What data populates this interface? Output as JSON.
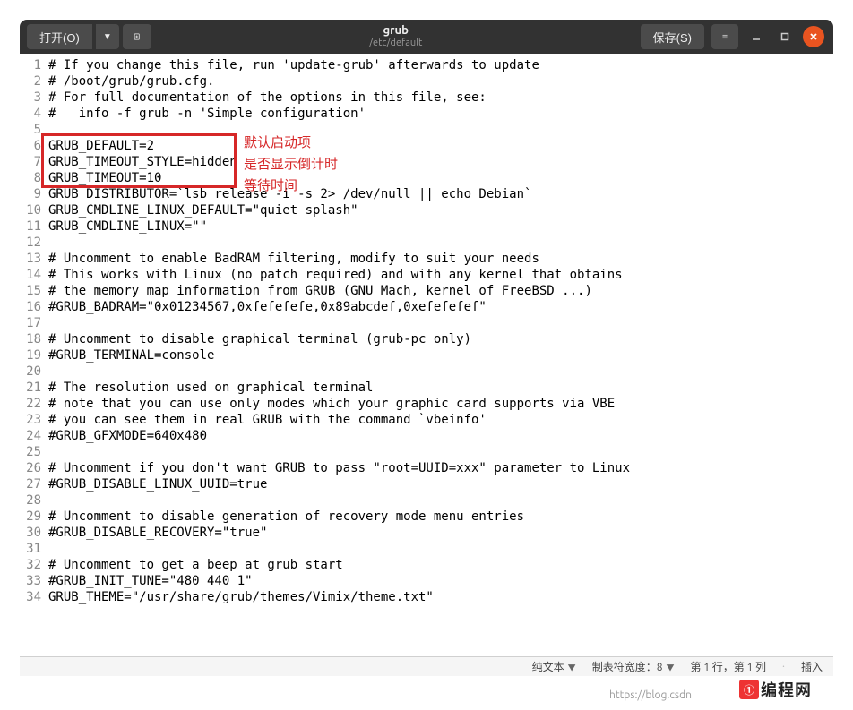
{
  "titlebar": {
    "open_label": "打开(O)",
    "save_label": "保存(S)",
    "title": "grub",
    "subtitle": "/etc/default"
  },
  "code_lines": [
    "# If you change this file, run 'update-grub' afterwards to update",
    "# /boot/grub/grub.cfg.",
    "# For full documentation of the options in this file, see:",
    "#   info -f grub -n 'Simple configuration'",
    "",
    "GRUB_DEFAULT=2",
    "GRUB_TIMEOUT_STYLE=hidden",
    "GRUB_TIMEOUT=10",
    "GRUB_DISTRIBUTOR=`lsb_release -i -s 2> /dev/null || echo Debian`",
    "GRUB_CMDLINE_LINUX_DEFAULT=\"quiet splash\"",
    "GRUB_CMDLINE_LINUX=\"\"",
    "",
    "# Uncomment to enable BadRAM filtering, modify to suit your needs",
    "# This works with Linux (no patch required) and with any kernel that obtains",
    "# the memory map information from GRUB (GNU Mach, kernel of FreeBSD ...)",
    "#GRUB_BADRAM=\"0x01234567,0xfefefefe,0x89abcdef,0xefefefef\"",
    "",
    "# Uncomment to disable graphical terminal (grub-pc only)",
    "#GRUB_TERMINAL=console",
    "",
    "# The resolution used on graphical terminal",
    "# note that you can use only modes which your graphic card supports via VBE",
    "# you can see them in real GRUB with the command `vbeinfo'",
    "#GRUB_GFXMODE=640x480",
    "",
    "# Uncomment if you don't want GRUB to pass \"root=UUID=xxx\" parameter to Linux",
    "#GRUB_DISABLE_LINUX_UUID=true",
    "",
    "# Uncomment to disable generation of recovery mode menu entries",
    "#GRUB_DISABLE_RECOVERY=\"true\"",
    "",
    "# Uncomment to get a beep at grub start",
    "#GRUB_INIT_TUNE=\"480 440 1\"",
    "GRUB_THEME=\"/usr/share/grub/themes/Vimix/theme.txt\""
  ],
  "annotations": {
    "a1": "默认启动项",
    "a2": "是否显示倒计时",
    "a3": "等待时间"
  },
  "statusbar": {
    "syntax": "纯文本",
    "tabwidth_label": "制表符宽度：",
    "tabwidth_value": "8",
    "position": "第 1 行，第 1 列",
    "insert_mode": "插入"
  },
  "watermark": {
    "url": "https://blog.csdn",
    "logo_text": "编程网",
    "logo_badge": "①"
  }
}
